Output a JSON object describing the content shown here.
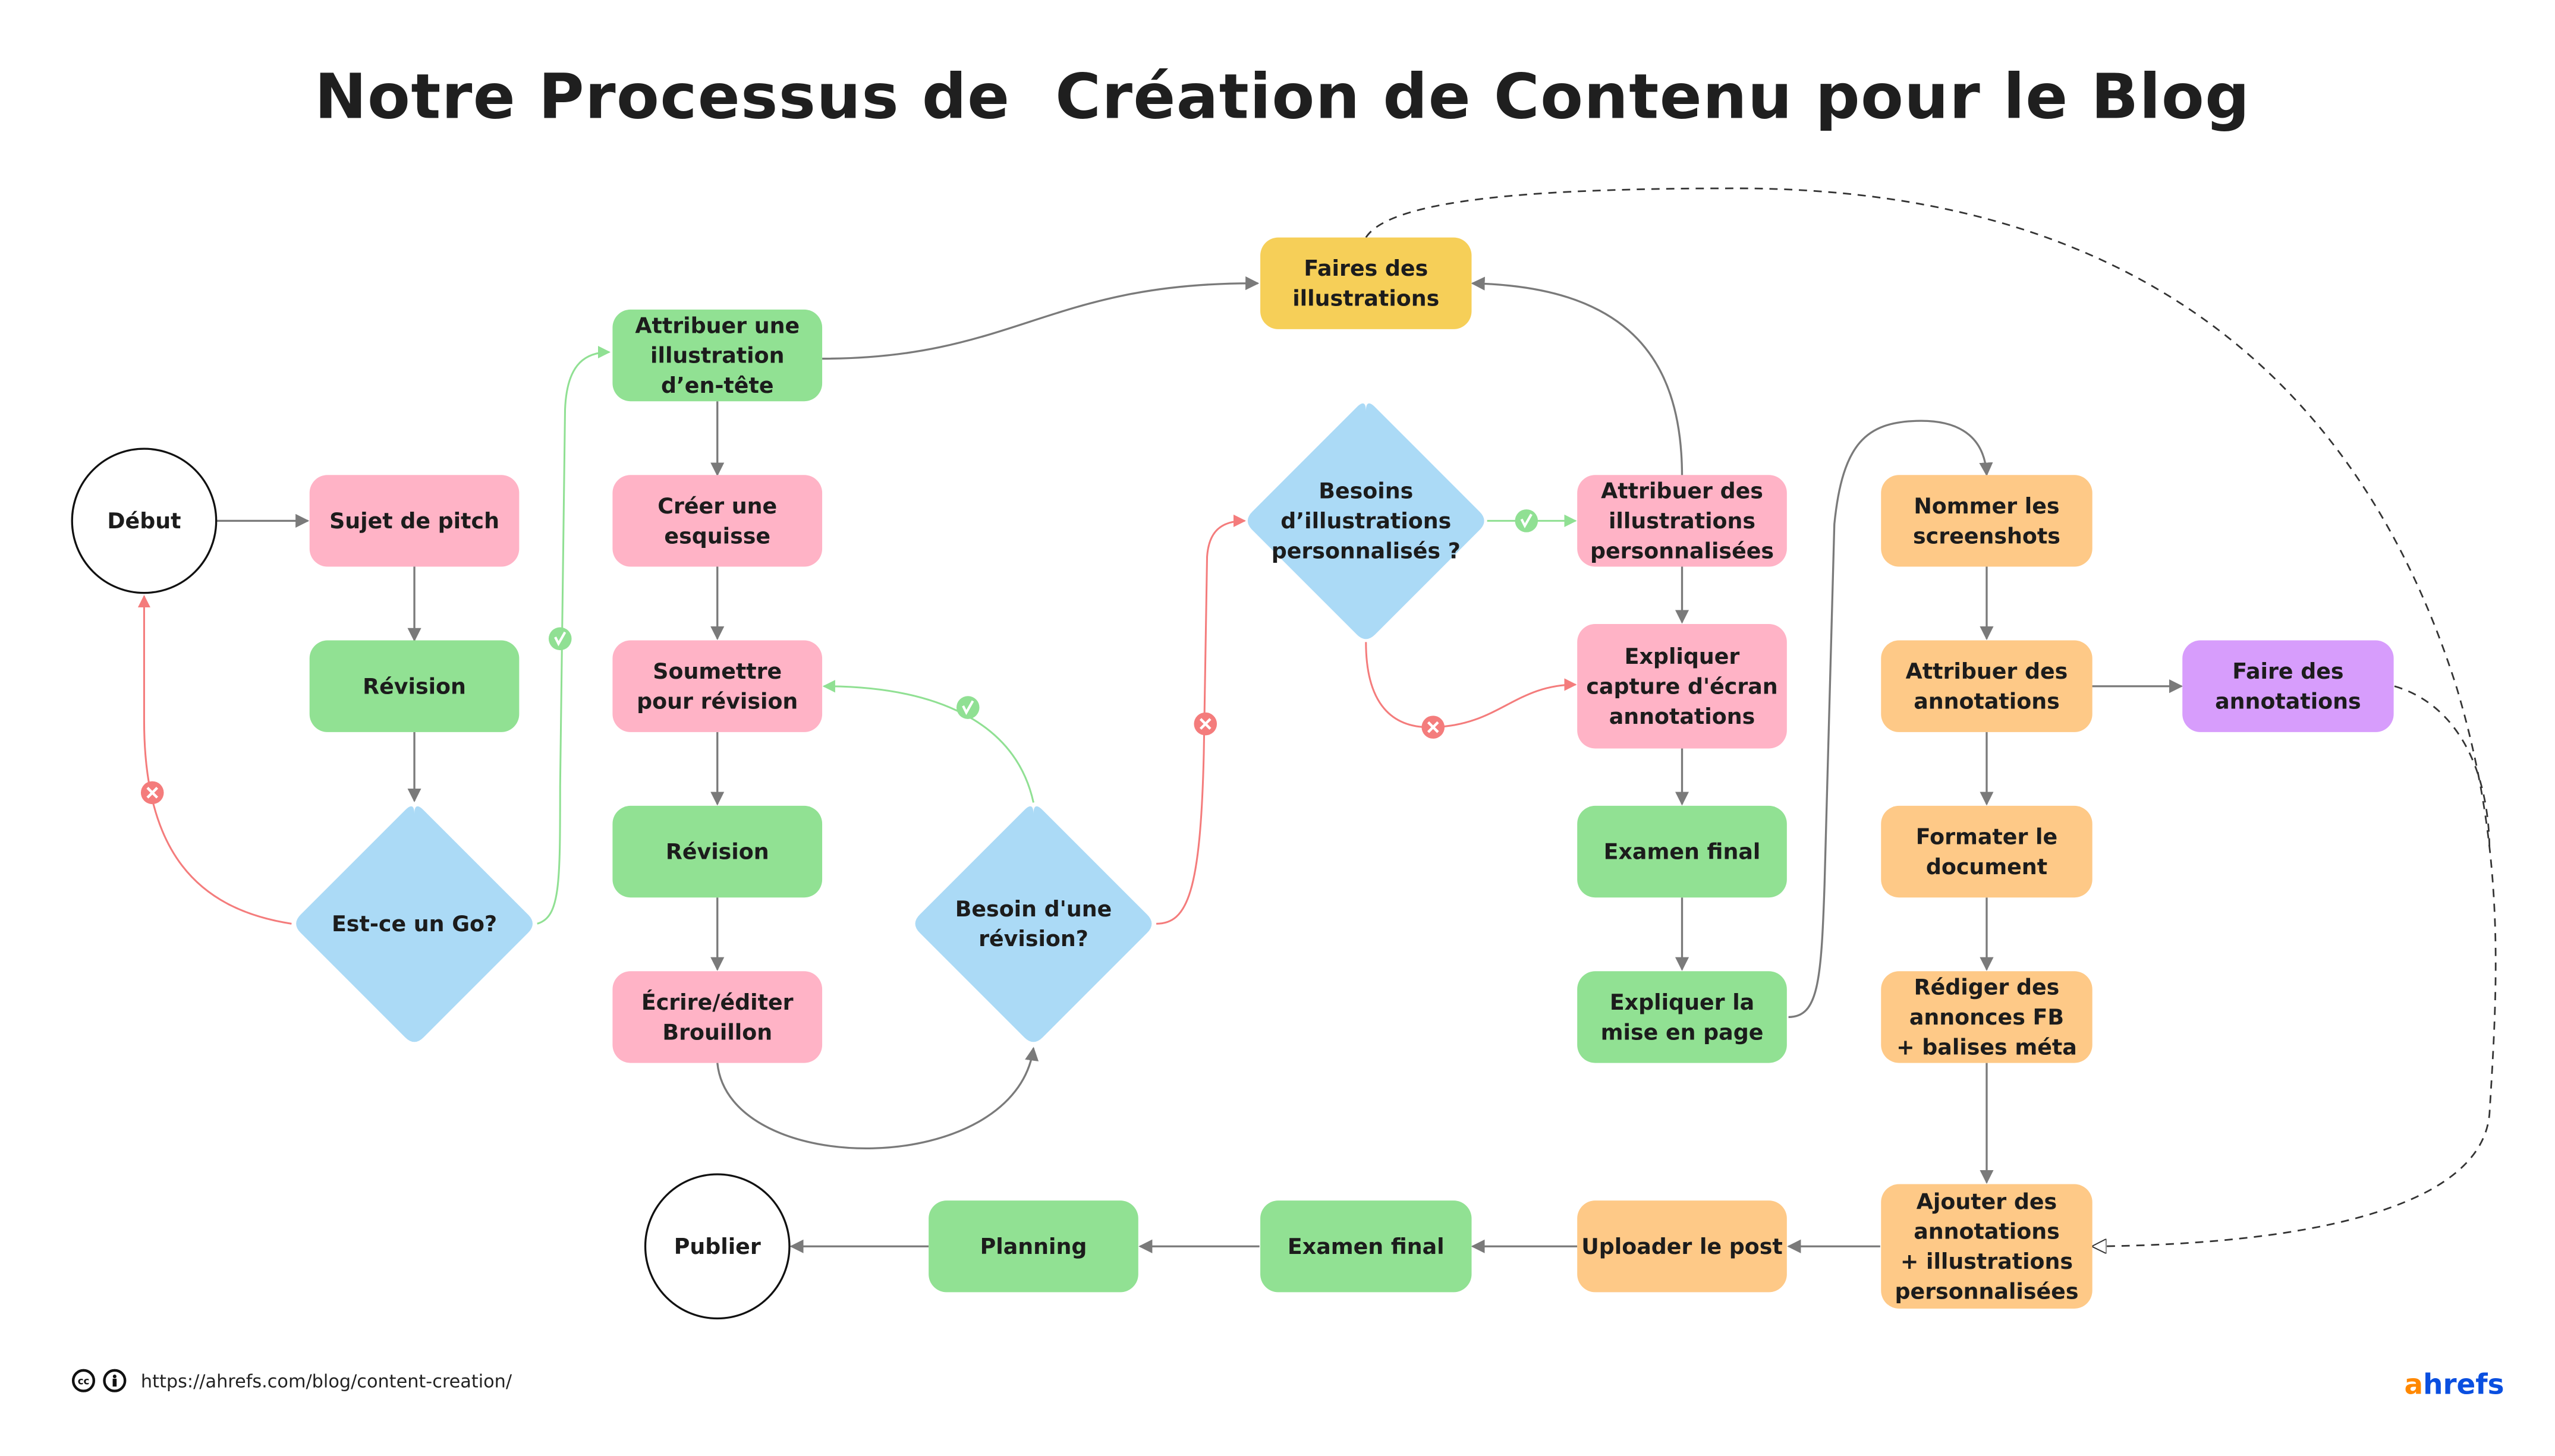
{
  "title": "Notre Processus de  Création de Contenu pour le Blog",
  "colors": {
    "pink": "#ffb3c6",
    "green": "#91e193",
    "blue": "#abdaf6",
    "yellow": "#f6cf58",
    "orange": "#fec987",
    "purple": "#d79dfc",
    "edge_gray": "#7a7a7a",
    "yes_green": "#90e093",
    "no_red": "#f47c7c",
    "logo_orange": "#ff8800",
    "logo_blue": "#0a4fe0"
  },
  "nodes": {
    "debut": {
      "lines": [
        "Début"
      ],
      "shape": "ellipse",
      "color": "white"
    },
    "sujet_pitch": {
      "lines": [
        "Sujet de pitch"
      ],
      "shape": "box",
      "color": "pink"
    },
    "revision_1": {
      "lines": [
        "Révision"
      ],
      "shape": "box",
      "color": "green"
    },
    "est_ce_go": {
      "lines": [
        "Est-ce un Go?"
      ],
      "shape": "diamond",
      "color": "blue"
    },
    "attribuer_entete": {
      "lines": [
        "Attribuer   une",
        "illustration",
        "d’en-tête"
      ],
      "shape": "box",
      "color": "green"
    },
    "creer_esquisse": {
      "lines": [
        "Créer une",
        "esquisse"
      ],
      "shape": "box",
      "color": "pink"
    },
    "soumettre": {
      "lines": [
        "Soumettre",
        "pour révision"
      ],
      "shape": "box",
      "color": "pink"
    },
    "revision_2": {
      "lines": [
        "Révision"
      ],
      "shape": "box",
      "color": "green"
    },
    "ecrire": {
      "lines": [
        "Écrire/éditer",
        "Brouillon"
      ],
      "shape": "box",
      "color": "pink"
    },
    "besoin_revision": {
      "lines": [
        "Besoin d'une",
        "révision?"
      ],
      "shape": "diamond",
      "color": "blue"
    },
    "faires_illustrations": {
      "lines": [
        "Faires des",
        "illustrations"
      ],
      "shape": "box",
      "color": "yellow"
    },
    "besoins_illus": {
      "lines": [
        "Besoins",
        "d’illustrations",
        "personnalisés ?"
      ],
      "shape": "diamond",
      "color": "blue"
    },
    "attribuer_illus": {
      "lines": [
        "Attribuer des",
        "illustrations",
        "personnalisées"
      ],
      "shape": "box",
      "color": "pink"
    },
    "expliquer_capture": {
      "lines": [
        "Expliquer",
        "capture d'écran",
        "annotations"
      ],
      "shape": "box",
      "color": "pink"
    },
    "examen_final_1": {
      "lines": [
        "Examen final"
      ],
      "shape": "box",
      "color": "green"
    },
    "expliquer_mise": {
      "lines": [
        "Expliquer la",
        "mise en page"
      ],
      "shape": "box",
      "color": "green"
    },
    "nommer_screens": {
      "lines": [
        "Nommer les",
        "screenshots"
      ],
      "shape": "box",
      "color": "orange"
    },
    "attribuer_annot": {
      "lines": [
        "Attribuer des",
        "annotations"
      ],
      "shape": "box",
      "color": "orange"
    },
    "faire_annot": {
      "lines": [
        "Faire des",
        "annotations"
      ],
      "shape": "box",
      "color": "purple"
    },
    "formater": {
      "lines": [
        "Formater le",
        "document"
      ],
      "shape": "box",
      "color": "orange"
    },
    "rediger": {
      "lines": [
        "Rédiger des",
        "annonces FB",
        "+ balises méta"
      ],
      "shape": "box",
      "color": "orange"
    },
    "ajouter": {
      "lines": [
        "Ajouter des",
        "annotations",
        "+ illustrations",
        "personnalisées"
      ],
      "shape": "box",
      "color": "orange"
    },
    "uploader": {
      "lines": [
        "Uploader le post"
      ],
      "shape": "box",
      "color": "orange"
    },
    "examen_final_2": {
      "lines": [
        "Examen final"
      ],
      "shape": "box",
      "color": "green"
    },
    "planning": {
      "lines": [
        "Planning"
      ],
      "shape": "box",
      "color": "green"
    },
    "publier": {
      "lines": [
        "Publier"
      ],
      "shape": "ellipse",
      "color": "white"
    }
  },
  "edges": [
    {
      "from": "debut",
      "to": "sujet_pitch",
      "kind": "normal"
    },
    {
      "from": "sujet_pitch",
      "to": "revision_1",
      "kind": "normal"
    },
    {
      "from": "revision_1",
      "to": "est_ce_go",
      "kind": "normal"
    },
    {
      "from": "est_ce_go",
      "to": "debut",
      "kind": "no",
      "badge": "✕"
    },
    {
      "from": "est_ce_go",
      "to": "attribuer_entete",
      "kind": "yes",
      "badge": "✓"
    },
    {
      "from": "attribuer_entete",
      "to": "creer_esquisse",
      "kind": "normal"
    },
    {
      "from": "attribuer_entete",
      "to": "faires_illustrations",
      "kind": "normal"
    },
    {
      "from": "creer_esquisse",
      "to": "soumettre",
      "kind": "normal"
    },
    {
      "from": "soumettre",
      "to": "revision_2",
      "kind": "normal"
    },
    {
      "from": "revision_2",
      "to": "ecrire",
      "kind": "normal"
    },
    {
      "from": "ecrire",
      "to": "besoin_revision",
      "kind": "normal"
    },
    {
      "from": "besoin_revision",
      "to": "soumettre",
      "kind": "yes",
      "badge": "✓"
    },
    {
      "from": "besoin_revision",
      "to": "besoins_illus",
      "kind": "no",
      "badge": "✕"
    },
    {
      "from": "besoins_illus",
      "to": "attribuer_illus",
      "kind": "yes",
      "badge": "✓"
    },
    {
      "from": "besoins_illus",
      "to": "expliquer_capture",
      "kind": "no",
      "badge": "✕"
    },
    {
      "from": "attribuer_illus",
      "to": "faires_illustrations",
      "kind": "normal"
    },
    {
      "from": "attribuer_illus",
      "to": "expliquer_capture",
      "kind": "normal"
    },
    {
      "from": "expliquer_capture",
      "to": "examen_final_1",
      "kind": "normal"
    },
    {
      "from": "examen_final_1",
      "to": "expliquer_mise",
      "kind": "normal"
    },
    {
      "from": "expliquer_mise",
      "to": "nommer_screens",
      "kind": "normal"
    },
    {
      "from": "nommer_screens",
      "to": "attribuer_annot",
      "kind": "normal"
    },
    {
      "from": "attribuer_annot",
      "to": "faire_annot",
      "kind": "normal"
    },
    {
      "from": "attribuer_annot",
      "to": "formater",
      "kind": "normal"
    },
    {
      "from": "formater",
      "to": "rediger",
      "kind": "normal"
    },
    {
      "from": "rediger",
      "to": "ajouter",
      "kind": "normal"
    },
    {
      "from": "faires_illustrations",
      "to": "ajouter",
      "kind": "dashed"
    },
    {
      "from": "faire_annot",
      "to": "ajouter",
      "kind": "dashed"
    },
    {
      "from": "ajouter",
      "to": "uploader",
      "kind": "normal"
    },
    {
      "from": "uploader",
      "to": "examen_final_2",
      "kind": "normal"
    },
    {
      "from": "examen_final_2",
      "to": "planning",
      "kind": "normal"
    },
    {
      "from": "planning",
      "to": "publier",
      "kind": "normal"
    }
  ],
  "footer": {
    "license_icons": [
      "cc-icon",
      "attribution-icon"
    ],
    "cc_label": "cc",
    "url": "https://ahrefs.com/blog/content-creation/",
    "logo_first": "a",
    "logo_rest": "hrefs"
  }
}
